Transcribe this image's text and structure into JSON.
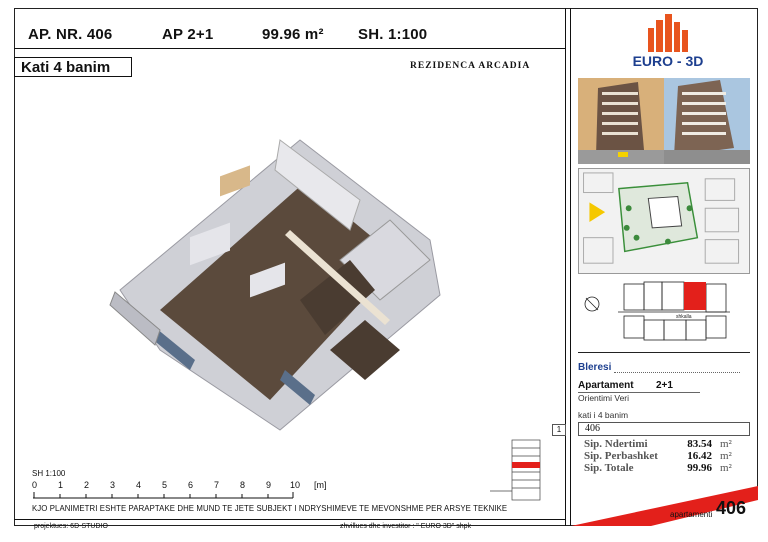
{
  "header": {
    "apartment_no": "AP. NR. 406",
    "type": "AP 2+1",
    "area": "99.96 m²",
    "scale": "SH. 1:100"
  },
  "floor_label": "Kati 4 banim",
  "project_name": "REZIDENCA ARCADIA",
  "logo": {
    "text": "EURO - 3D",
    "colors": {
      "orange": "#e8541e",
      "blue": "#1d3f8f"
    }
  },
  "site_label": "shkalla",
  "buyer": {
    "label": "Bleresi",
    "apartment_label": "Apartament",
    "apartment_type": "2+1",
    "orientation": "Orientimi  Veri",
    "floor": "kati i 4 banim",
    "number": "406",
    "marker": "1"
  },
  "areas": [
    {
      "label": "Sip. Ndertimi",
      "value": "83.54",
      "unit": "m²"
    },
    {
      "label": "Sip. Perbashket",
      "value": "16.42",
      "unit": "m²"
    },
    {
      "label": "Sip. Totale",
      "value": "99.96",
      "unit": "m²"
    }
  ],
  "scale_bar": {
    "label": "SH 1:100",
    "ticks": [
      "0",
      "1",
      "2",
      "3",
      "4",
      "5",
      "6",
      "7",
      "8",
      "9",
      "10"
    ],
    "unit": "[m]"
  },
  "disclaimer": "KJO PLANIMETRI ESHTE PARAPTAKE DHE MUND TE JETE SUBJEKT I NDRYSHIMEVE TE MEVONSHME PER ARSYE TEKNIKE",
  "footer": {
    "left": "projektues:  6D-STUDIO",
    "right": "zhvillues dhe investitor :  \" EURO 3D\" shpk"
  },
  "corner_badge": {
    "label": "apartamenti",
    "number": "406",
    "color": "#e3201b"
  }
}
